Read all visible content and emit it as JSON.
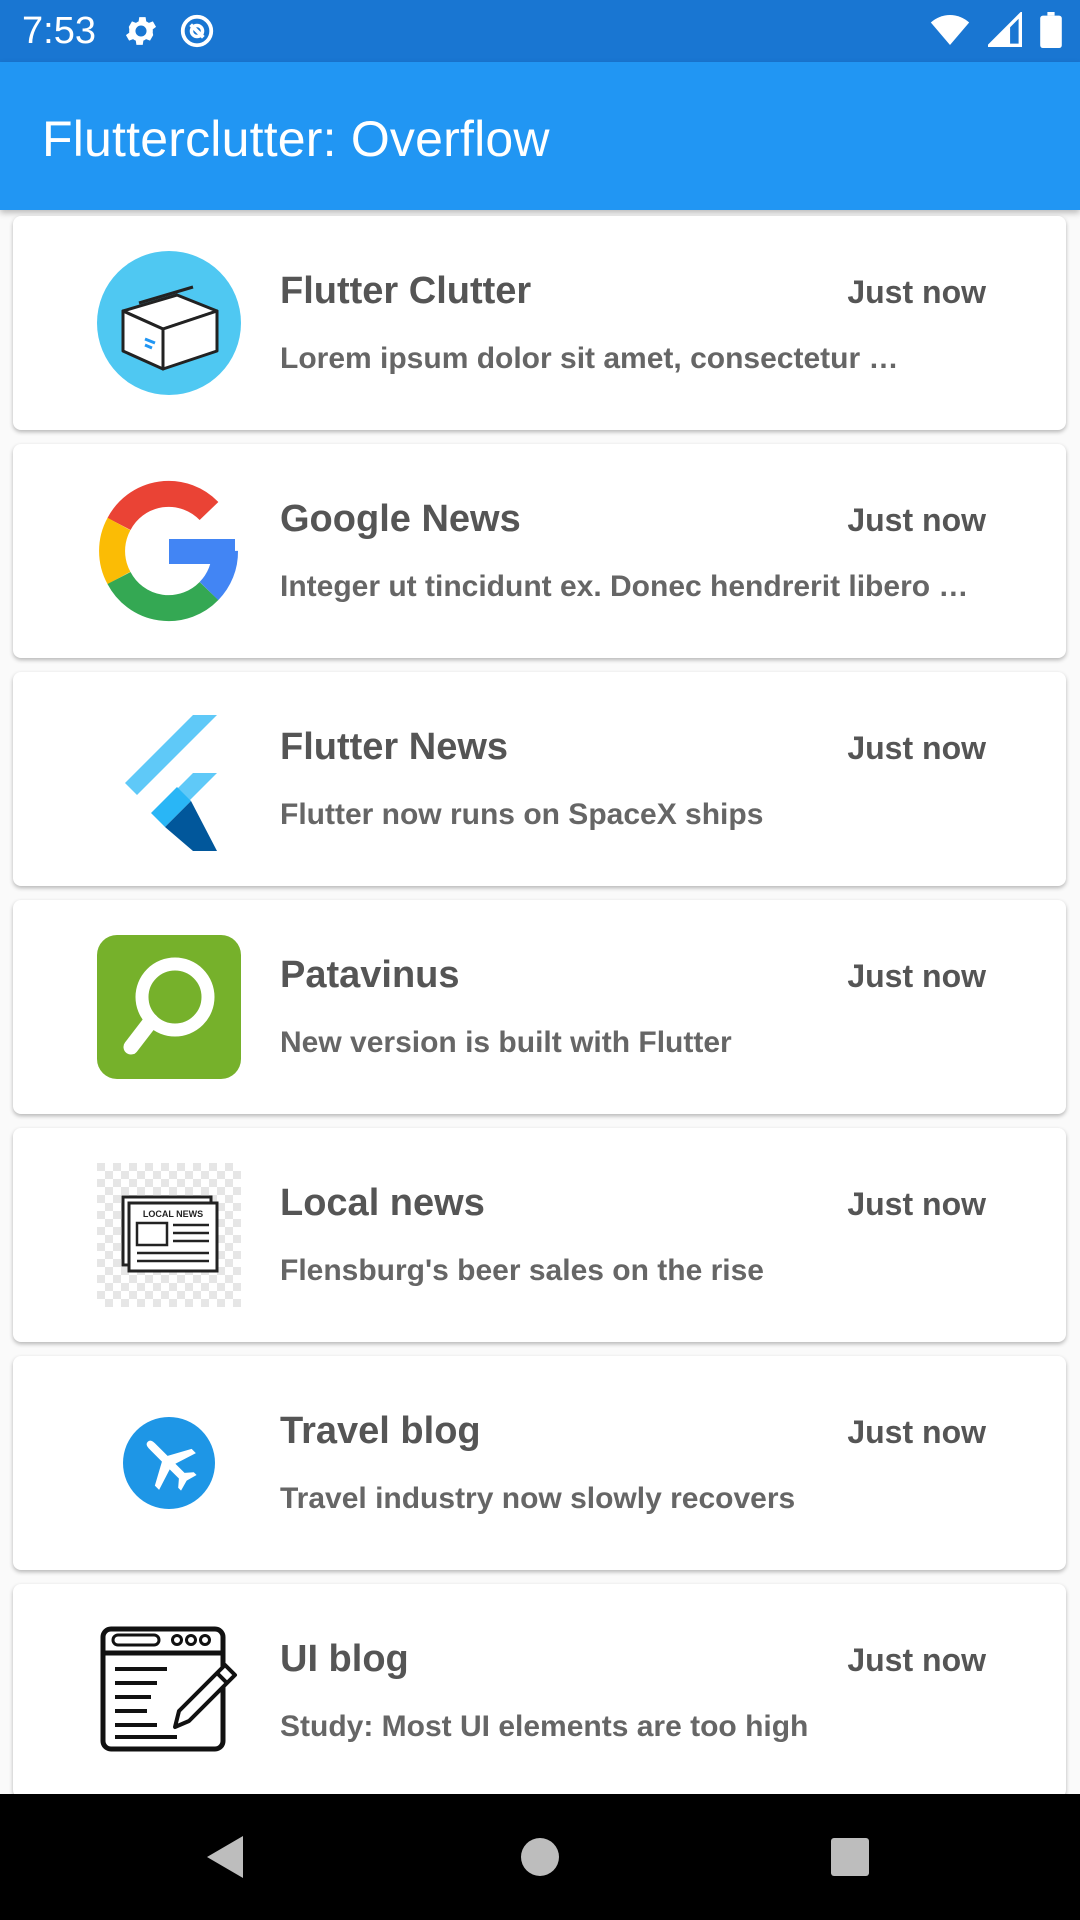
{
  "status_bar": {
    "time": "7:53",
    "left_icons": [
      "settings-icon",
      "sync-icon"
    ],
    "right_icons": [
      "wifi-icon",
      "cell-signal-icon",
      "battery-icon"
    ]
  },
  "app_bar": {
    "title": "Flutterclutter: Overflow",
    "color": "#2196f3",
    "status_color": "#1976d2"
  },
  "items": [
    {
      "icon": "box-icon",
      "title": "Flutter Clutter",
      "time": "Just now",
      "subtitle": "Lorem ipsum dolor sit amet, consectetur …"
    },
    {
      "icon": "google-icon",
      "title": "Google News",
      "time": "Just now",
      "subtitle": "Integer ut tincidunt ex. Donec hendrerit libero …"
    },
    {
      "icon": "flutter-logo-icon",
      "title": "Flutter News",
      "time": "Just now",
      "subtitle": "Flutter now runs on SpaceX ships"
    },
    {
      "icon": "patavinus-logo-icon",
      "title": "Patavinus",
      "time": "Just now",
      "subtitle": "New version is built with Flutter"
    },
    {
      "icon": "newspaper-icon",
      "title": "Local news",
      "time": "Just now",
      "subtitle": "Flensburg's beer sales on the rise"
    },
    {
      "icon": "airplane-icon",
      "title": "Travel blog",
      "time": "Just now",
      "subtitle": "Travel industry now slowly recovers"
    },
    {
      "icon": "blog-icon",
      "title": "UI blog",
      "time": "Just now",
      "subtitle": "Study: Most UI elements are too high"
    }
  ],
  "newspaper_icon_text": "LOCAL NEWS",
  "nav_bar": {
    "buttons": [
      "back-icon",
      "home-icon",
      "recents-icon"
    ]
  }
}
